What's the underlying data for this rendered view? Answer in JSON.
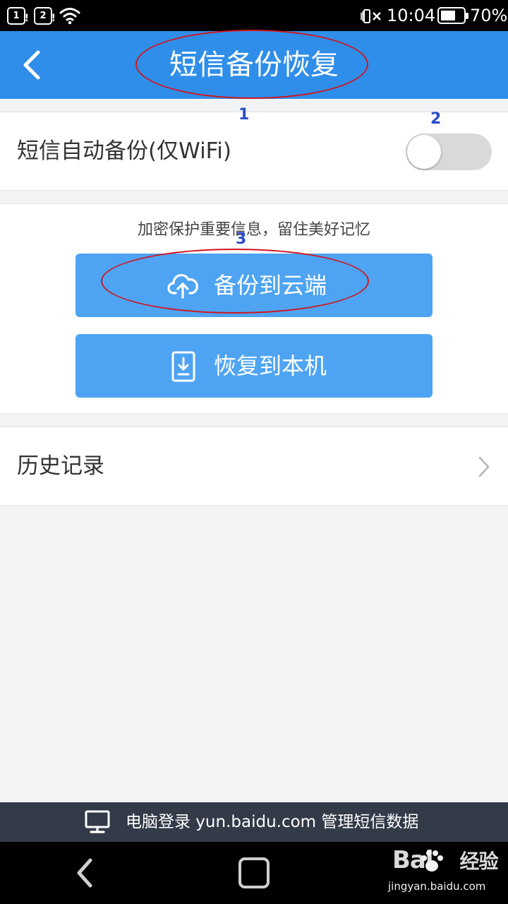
{
  "status_bar": {
    "sim1": "1",
    "sim2": "2",
    "sim_alert": "!",
    "time": "10:04",
    "battery_percent": "70%",
    "battery_level": 0.7
  },
  "header": {
    "title": "短信备份恢复"
  },
  "annotations": [
    "1",
    "2",
    "3"
  ],
  "auto_backup": {
    "label": "短信自动备份(仅WiFi)",
    "enabled": false
  },
  "backup": {
    "tagline": "加密保护重要信息，留住美好记忆",
    "cloud_button": "备份到云端",
    "restore_button": "恢复到本机"
  },
  "history": {
    "label": "历史记录"
  },
  "banner": {
    "text": "电脑登录 yun.baidu.com 管理短信数据"
  },
  "watermark": {
    "logo": "Bai",
    "logo_suffix": "经验",
    "url": "jingyan.baidu.com"
  },
  "colors": {
    "header_blue": "#2f8ee9",
    "button_blue": "#4ea4f2",
    "annotation_red": "#d0161f",
    "annotation_blue": "#2b4dc7",
    "banner_dark": "#333a48"
  }
}
